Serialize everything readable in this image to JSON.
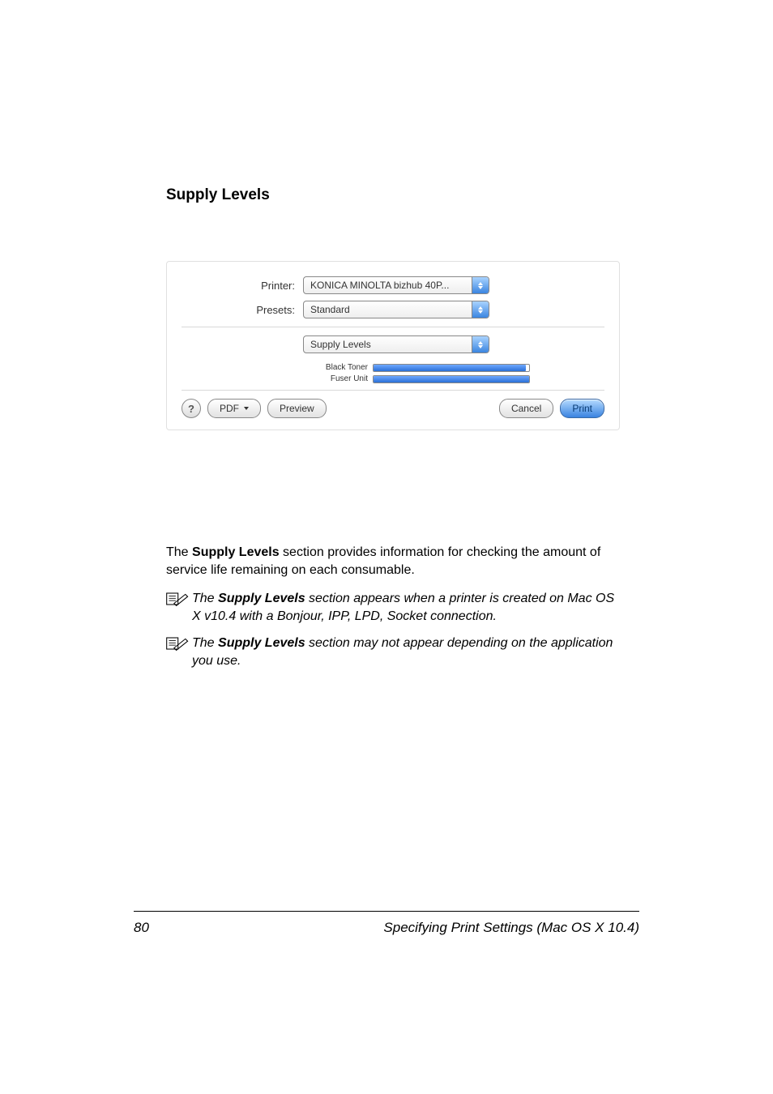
{
  "heading": "Supply Levels",
  "dialog": {
    "printer_label": "Printer:",
    "printer_value": "KONICA MINOLTA bizhub 40P...",
    "presets_label": "Presets:",
    "presets_value": "Standard",
    "pane_value": "Supply Levels",
    "supplies": [
      {
        "label": "Black Toner",
        "pct": 98
      },
      {
        "label": "Fuser Unit",
        "pct": 100
      }
    ],
    "help": "?",
    "pdf_btn": "PDF",
    "preview_btn": "Preview",
    "cancel_btn": "Cancel",
    "print_btn": "Print"
  },
  "body": {
    "p1a": "The ",
    "p1b": "Supply Levels",
    "p1c": " section provides information for checking the amount of service life remaining on each consumable.",
    "note1a": "The ",
    "note1b": "Supply Levels",
    "note1c": " section appears when a printer is created on Mac OS X v10.4 with a Bonjour, IPP, LPD, Socket connection.",
    "note2a": "The ",
    "note2b": "Supply Levels",
    "note2c": " section may not appear depending on the application you use."
  },
  "footer": {
    "page": "80",
    "title": "Specifying Print Settings (Mac OS X 10.4)"
  }
}
